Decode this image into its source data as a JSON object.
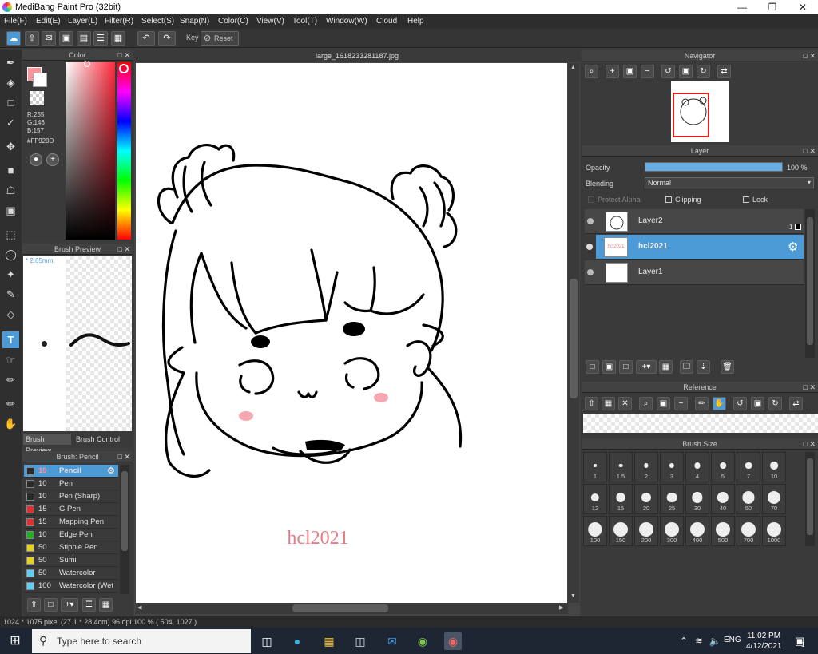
{
  "window": {
    "title": "MediBang Paint Pro (32bit)"
  },
  "menu": [
    "File(F)",
    "Edit(E)",
    "Layer(L)",
    "Filter(R)",
    "Select(S)",
    "Snap(N)",
    "Color(C)",
    "View(V)",
    "Tool(T)",
    "Window(W)",
    "Cloud",
    "Help"
  ],
  "toolbar": {
    "key_label": "Key",
    "reset_label": "Reset"
  },
  "color_panel": {
    "title": "Color",
    "r": "R:255",
    "g": "G:146",
    "b": "B:157",
    "hex": "#FF929D",
    "fg_color": "#FF929D"
  },
  "brush_preview": {
    "title": "Brush Preview",
    "size": "* 2.65mm",
    "tab1": "Brush Preview",
    "tab2": "Brush Control"
  },
  "brush_list": {
    "title": "Brush: Pencil",
    "items": [
      {
        "size": "10",
        "name": "Pencil",
        "color": "#2a2a2a",
        "selected": true
      },
      {
        "size": "10",
        "name": "Pen",
        "color": "#2a2a2a"
      },
      {
        "size": "10",
        "name": "Pen (Sharp)",
        "color": "#2a2a2a"
      },
      {
        "size": "15",
        "name": "G Pen",
        "color": "#e03030"
      },
      {
        "size": "15",
        "name": "Mapping Pen",
        "color": "#e03030"
      },
      {
        "size": "10",
        "name": "Edge Pen",
        "color": "#20b020"
      },
      {
        "size": "50",
        "name": "Stipple Pen",
        "color": "#e6d020"
      },
      {
        "size": "50",
        "name": "Sumi",
        "color": "#e6d020"
      },
      {
        "size": "50",
        "name": "Watercolor",
        "color": "#60d0f0"
      },
      {
        "size": "100",
        "name": "Watercolor (Wet",
        "color": "#60d0f0"
      }
    ]
  },
  "document": {
    "tab": "large_1618233281187.jpg",
    "signature": "hcl2021"
  },
  "navigator": {
    "title": "Navigator"
  },
  "layer_panel": {
    "title": "Layer",
    "opacity_label": "Opacity",
    "opacity_value": "100 %",
    "opacity": 1.0,
    "blending_label": "Blending",
    "blending_value": "Normal",
    "protect_alpha": "Protect Alpha",
    "clipping": "Clipping",
    "lock": "Lock",
    "layers": [
      {
        "name": "Layer2",
        "badge": "1"
      },
      {
        "name": "hcl2021",
        "selected": true
      },
      {
        "name": "Layer1"
      }
    ]
  },
  "reference": {
    "title": "Reference"
  },
  "brush_size": {
    "title": "Brush Size",
    "sizes": [
      "1",
      "1.5",
      "2",
      "3",
      "4",
      "5",
      "7",
      "10",
      "12",
      "15",
      "20",
      "25",
      "30",
      "40",
      "50",
      "70",
      "100",
      "150",
      "200",
      "300",
      "400",
      "500",
      "700",
      "1000"
    ]
  },
  "status": {
    "text": "1024 * 1075 pixel  (27.1 * 28.4cm)  96 dpi  100 %  ( 504, 1027 )"
  },
  "taskbar": {
    "search_placeholder": "Type here to search",
    "lang": "ENG",
    "time": "11:02 PM",
    "date": "4/12/2021",
    "notification_count": "1"
  }
}
